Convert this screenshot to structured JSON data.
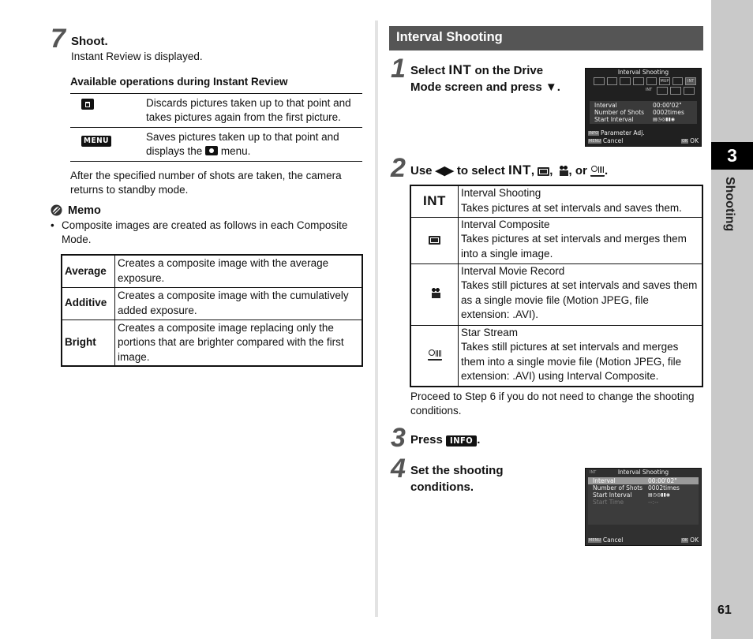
{
  "left": {
    "step7": {
      "number": "7",
      "title": "Shoot.",
      "text": "Instant Review is displayed."
    },
    "operations": {
      "heading": "Available operations during Instant Review",
      "rows": [
        {
          "icon": "trash-button-icon",
          "key_label": "",
          "text": "Discards pictures taken up to that point and takes pictures again from the first picture."
        },
        {
          "icon": "menu-button-icon",
          "key_label": "MENU",
          "text_before": "Saves pictures taken up to that point and displays the",
          "text_after": "menu."
        }
      ]
    },
    "after_text": "After the specified number of shots are taken, the camera returns to standby mode.",
    "memo": {
      "title": "Memo",
      "bullet": "Composite images are created as follows in each Composite Mode.",
      "table": [
        {
          "mode": "Average",
          "desc": "Creates a composite image with the average exposure."
        },
        {
          "mode": "Additive",
          "desc": "Creates a composite image with the cumulatively added exposure."
        },
        {
          "mode": "Bright",
          "desc": "Creates a composite image replacing only the portions that are brighter compared with the first image."
        }
      ]
    }
  },
  "right": {
    "section_title": "Interval Shooting",
    "step1": {
      "number": "1",
      "title_a": "Select",
      "glyph": "INT",
      "title_b": "on the Drive Mode screen and press ▼."
    },
    "screen1": {
      "title": "Interval Shooting",
      "drive_icons": [
        "□",
        "□",
        "⏲",
        "▯",
        "◩",
        "MUP",
        "▭",
        "INT"
      ],
      "sub_icons": [
        "INT",
        "▭",
        "●●",
        "☄"
      ],
      "rows": [
        {
          "label": "Interval",
          "value": "00:00'02\""
        },
        {
          "label": "Number of Shots",
          "value": "0002times"
        },
        {
          "label": "Start Interval",
          "value": "▤◷◎▮▮◉"
        }
      ],
      "info_tag": "INFO",
      "info_label": "Parameter Adj.",
      "menu_tag": "MENU",
      "cancel": "Cancel",
      "ok_tag": "OK",
      "ok": "OK"
    },
    "step2": {
      "number": "2",
      "text_a": "Use ◀▶ to select",
      "glyph": "INT",
      "text_b": ", or"
    },
    "modes": [
      {
        "icon": "INT",
        "name": "Interval Shooting",
        "desc": "Takes pictures at set intervals and saves them."
      },
      {
        "icon": "interval-composite",
        "name": "Interval Composite",
        "desc": "Takes pictures at set intervals and merges them into a single image."
      },
      {
        "icon": "interval-movie",
        "name": "Interval Movie Record",
        "desc": "Takes still pictures at set intervals and saves them as a single movie file (Motion JPEG, file extension: .AVI)."
      },
      {
        "icon": "star-stream",
        "name": "Star Stream",
        "desc": "Takes still pictures at set intervals and merges them into a single movie file (Motion JPEG, file extension: .AVI) using Interval Composite."
      }
    ],
    "proceed_text": "Proceed to Step 6 if you do not need to change the shooting conditions.",
    "step3": {
      "number": "3",
      "text": "Press",
      "key": "INFO"
    },
    "step4": {
      "number": "4",
      "title": "Set the shooting conditions."
    },
    "screen2": {
      "tag": "INT",
      "title": "Interval Shooting",
      "rows": [
        {
          "label": "Interval",
          "value": "00:00'02\"",
          "selected": true
        },
        {
          "label": "Number of Shots",
          "value": "0002times"
        },
        {
          "label": "Start Interval",
          "value": "▤◷◎▮▮◉"
        },
        {
          "label": "Start Time",
          "value": "--:--",
          "disabled": true
        }
      ],
      "menu_tag": "MENU",
      "cancel": "Cancel",
      "ok_tag": "OK",
      "ok": "OK"
    }
  },
  "side": {
    "chapter_number": "3",
    "chapter_label": "Shooting",
    "page_number": "61"
  }
}
